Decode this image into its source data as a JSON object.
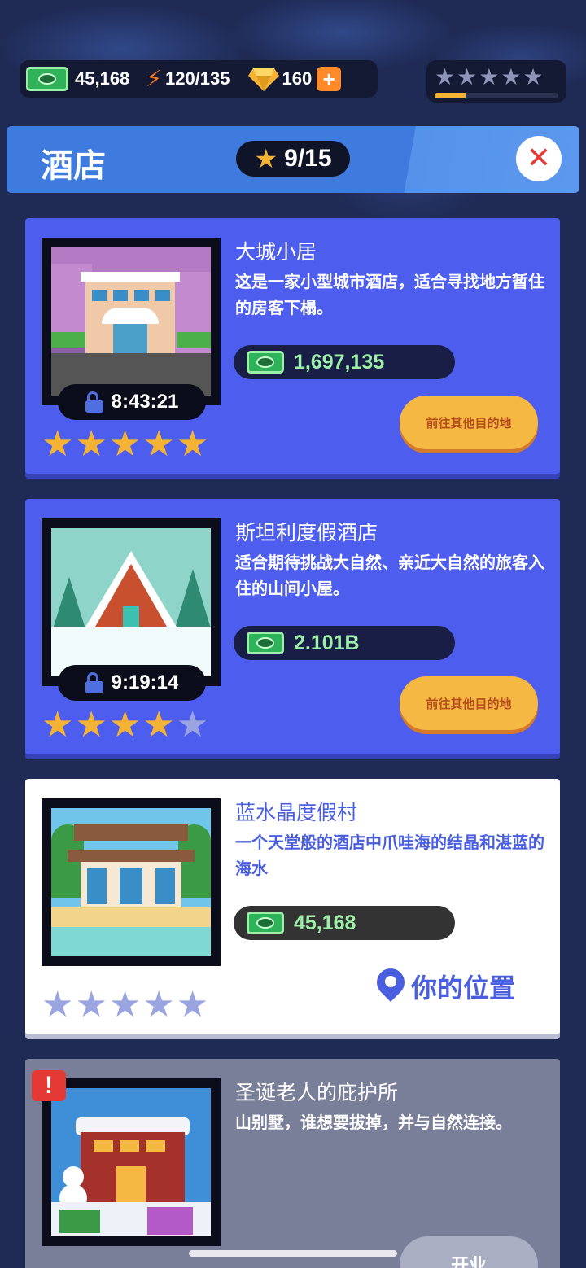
{
  "resources": {
    "cash": "45,168",
    "energy": "120/135",
    "gems": "160",
    "plus": "+"
  },
  "rating": {
    "stars_total": 5,
    "progress_fraction": 0.25
  },
  "header": {
    "title": "酒店",
    "progress": "9/15",
    "close": "✕"
  },
  "hotels": [
    {
      "name": "大城小居",
      "description": "这是一家小型城市酒店，适合寻找地方暂住的房客下榻。",
      "price": "1,697,135",
      "timer": "8:43:21",
      "stars_filled": 5,
      "action": "前往其他目的地"
    },
    {
      "name": "斯坦利度假酒店",
      "description": "适合期待挑战大自然、亲近大自然的旅客入住的山间小屋。",
      "price": "2.101B",
      "timer": "9:19:14",
      "stars_filled": 4,
      "action": "前往其他目的地"
    },
    {
      "name": "蓝水晶度假村",
      "description": "一个天堂般的酒店中爪哇海的结晶和湛蓝的海水",
      "price": "45,168",
      "stars_filled": 0,
      "action": "你的位置"
    },
    {
      "name": "圣诞老人的庇护所",
      "description": "山别墅，谁想要拔掉，并与自然连接。",
      "alert": "!",
      "action": "开业"
    }
  ],
  "colors": {
    "background": "#1f2a55",
    "card_blue": "#4d5ded",
    "gold": "#f5b335",
    "cash_green": "#9ef0a8",
    "button_orange": "#f5b843"
  },
  "icons": [
    "cash-icon",
    "bolt-icon",
    "gem-icon",
    "plus-icon",
    "star-icon",
    "close-icon",
    "lock-icon",
    "location-pin-icon",
    "alert-icon"
  ]
}
